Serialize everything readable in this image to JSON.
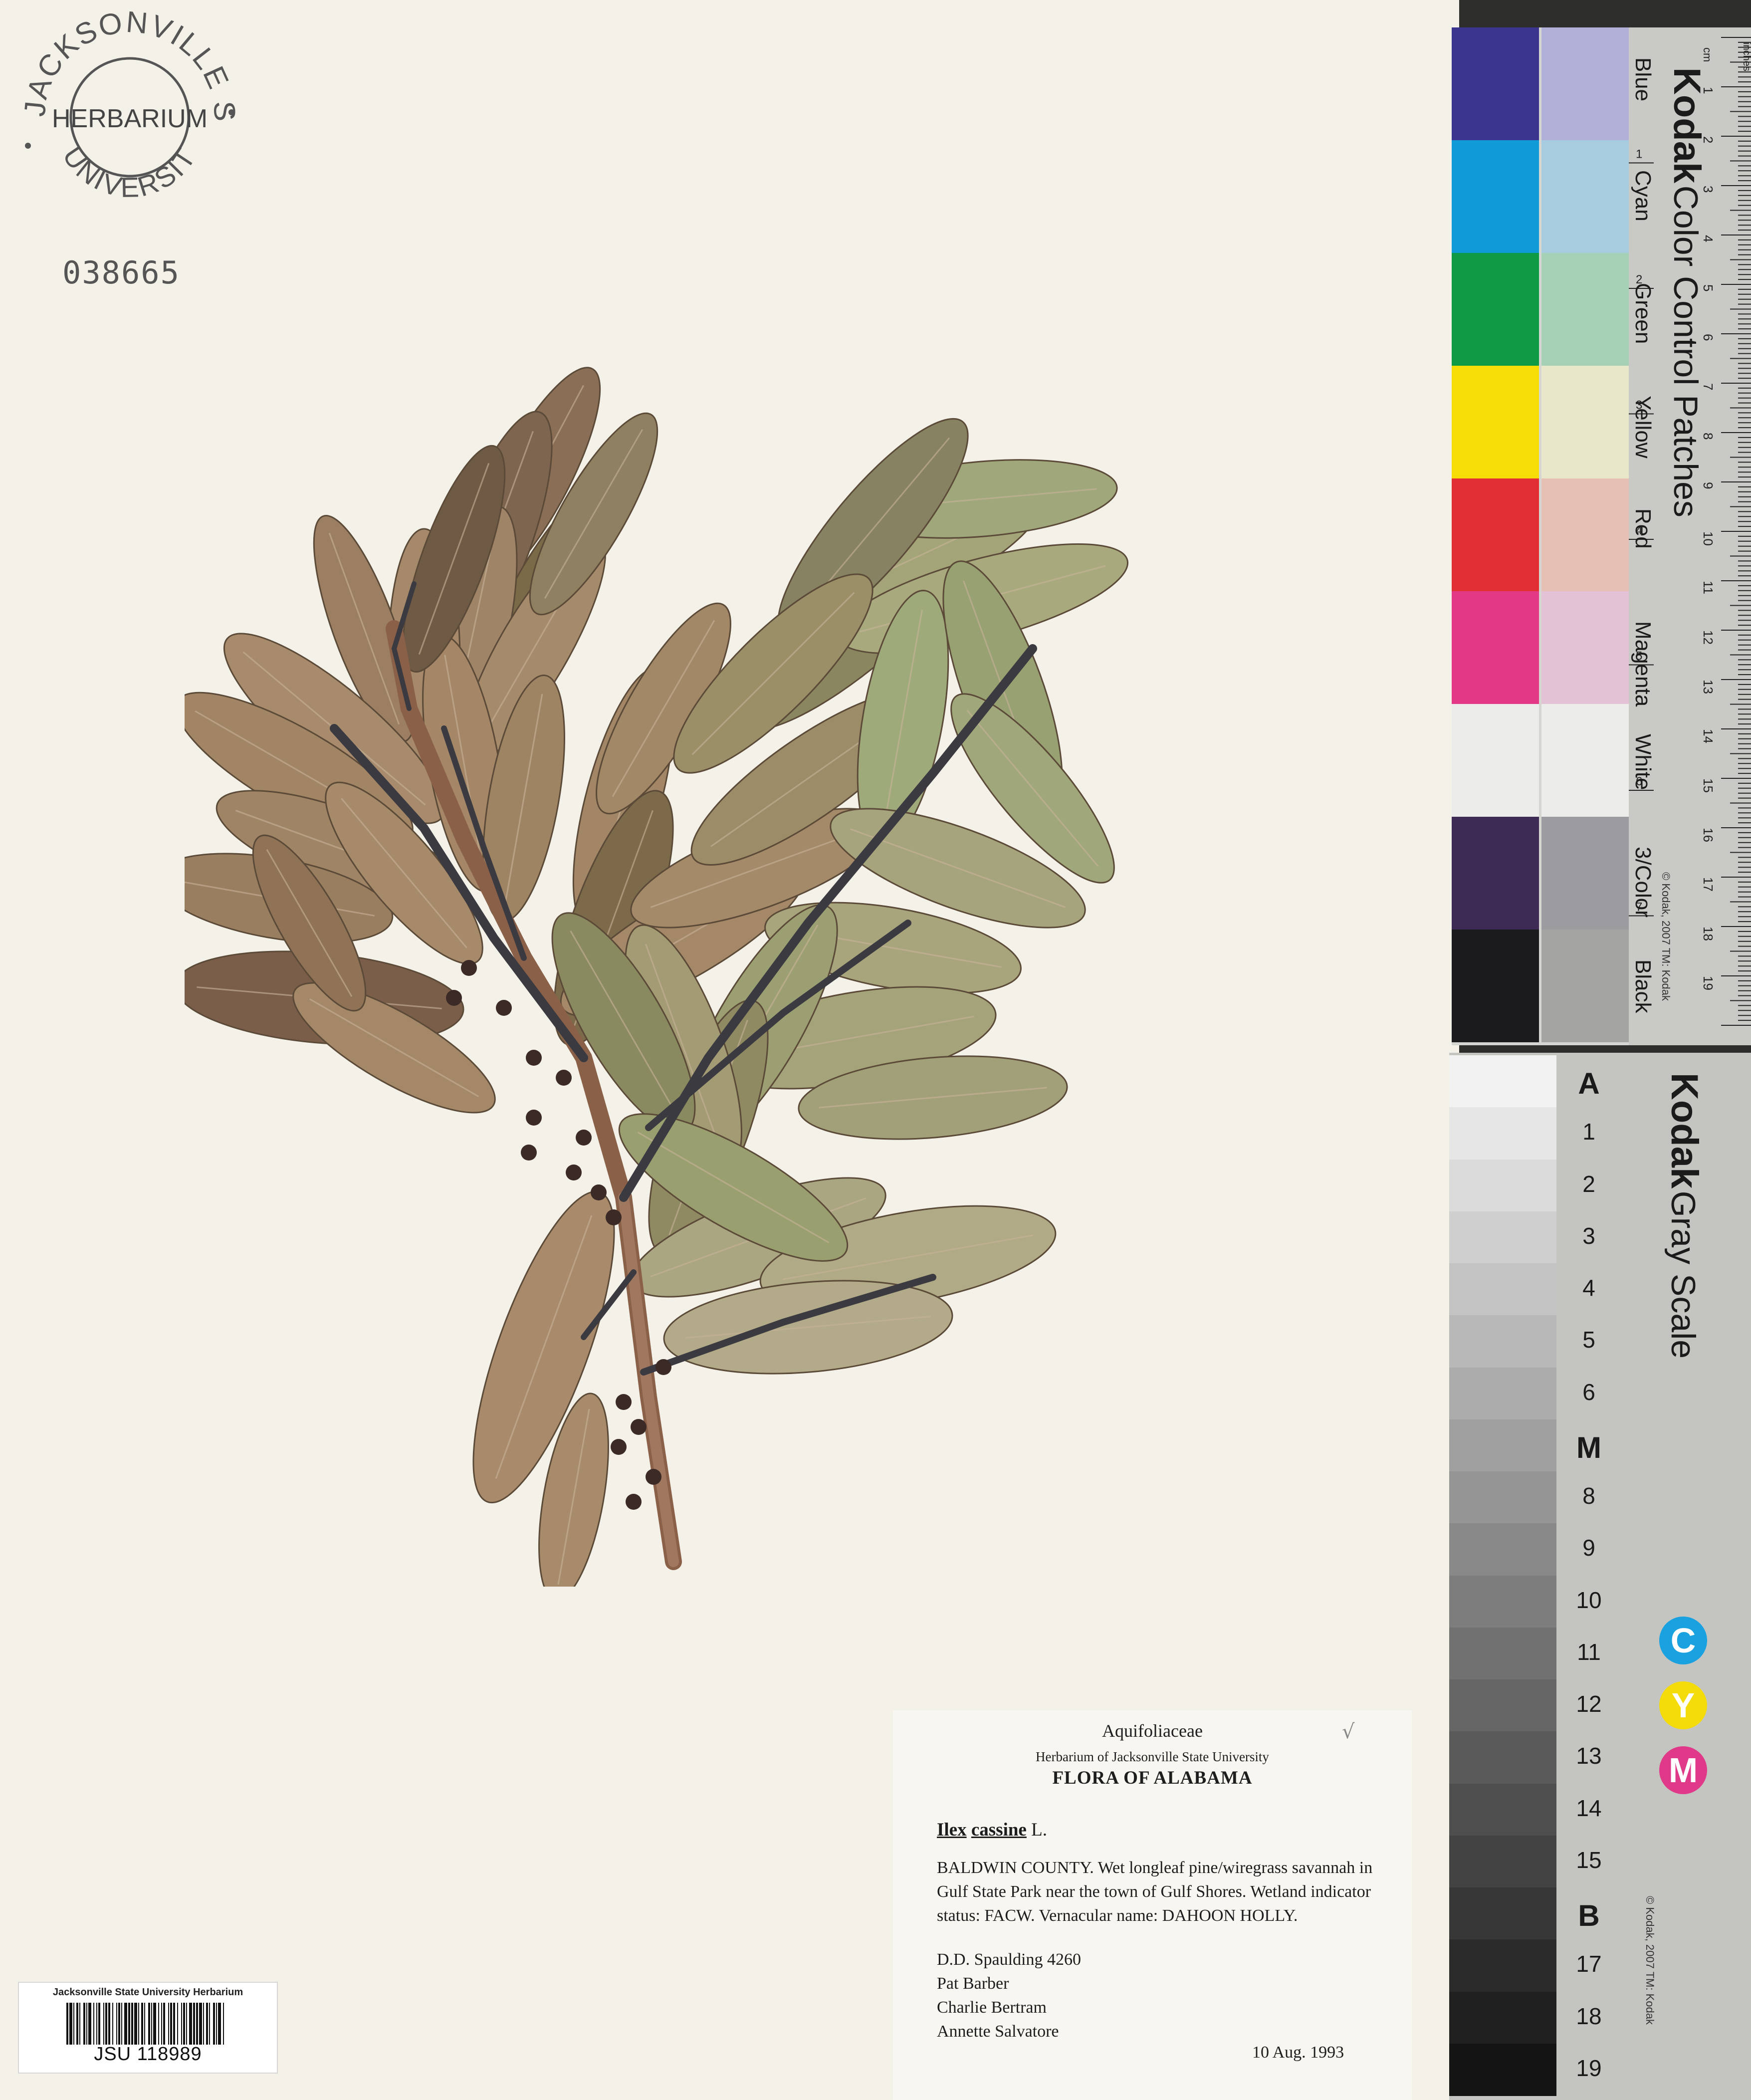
{
  "stamp": {
    "top_text": "JACKSONVILLE STATE",
    "center_text": "HERBARIUM",
    "bottom_text": "UNIVERSITY"
  },
  "accession_number": "038665",
  "label": {
    "family": "Aquifoliaceae",
    "herbarium": "Herbarium of Jacksonville State University",
    "flora": "FLORA OF ALABAMA",
    "genus": "Ilex",
    "species": "cassine",
    "author": "L.",
    "locality": "BALDWIN COUNTY.  Wet longleaf pine/wiregrass savannah in Gulf State Park near the town of Gulf Shores. Wetland indicator status: FACW. Vernacular name: DAHOON HOLLY.",
    "collectors": [
      "D.D. Spaulding 4260",
      "Pat Barber",
      "Charlie Bertram",
      "Annette Salvatore"
    ],
    "date": "10 Aug. 1993",
    "check_mark": "√"
  },
  "barcode": {
    "institution": "Jacksonville State University Herbarium",
    "number": "JSU 118989"
  },
  "color_card": {
    "brand": "Kodak",
    "title": "Color Control Patches",
    "copyright": "© Kodak, 2007 TM: Kodak",
    "patches": [
      {
        "name": "Blue",
        "dark": "#3c3590",
        "light": "#b0b0d8"
      },
      {
        "name": "Cyan",
        "dark": "#119ad8",
        "light": "#a7ccdf"
      },
      {
        "name": "Green",
        "dark": "#0f9a45",
        "light": "#a6d1b6"
      },
      {
        "name": "Yellow",
        "dark": "#f6dd08",
        "light": "#e8e7c9"
      },
      {
        "name": "Red",
        "dark": "#e22f34",
        "light": "#e6c0b5"
      },
      {
        "name": "Magenta",
        "dark": "#e23886",
        "light": "#e4c2d6"
      },
      {
        "name": "White",
        "dark": "#ecedeb",
        "light": "#ecedeb"
      },
      {
        "name": "3/Color",
        "dark": "#3e2b55",
        "light": "#9c9ca0"
      },
      {
        "name": "Black",
        "dark": "#1b1b1d",
        "light": "#a4a5a3"
      }
    ],
    "ruler_units": [
      "cm",
      "inches"
    ],
    "cm_ticks": [
      "1",
      "2",
      "3",
      "4",
      "5",
      "6",
      "7",
      "8",
      "9",
      "10",
      "11",
      "12",
      "13",
      "14",
      "15",
      "16",
      "17",
      "18",
      "19"
    ],
    "inch_ticks": [
      "1",
      "2",
      "3",
      "4",
      "5",
      "6",
      "7",
      "8"
    ]
  },
  "gray_card": {
    "brand": "Kodak",
    "title": "Gray Scale",
    "copyright": "© Kodak, 2007 TM: Kodak",
    "steps": [
      "A",
      "1",
      "2",
      "3",
      "4",
      "5",
      "6",
      "M",
      "8",
      "9",
      "10",
      "11",
      "12",
      "13",
      "14",
      "15",
      "B",
      "17",
      "18",
      "19"
    ],
    "cym": [
      "C",
      "Y",
      "M"
    ],
    "cym_colors": [
      "#1aa1e0",
      "#f3dc0a",
      "#e0398a"
    ]
  }
}
